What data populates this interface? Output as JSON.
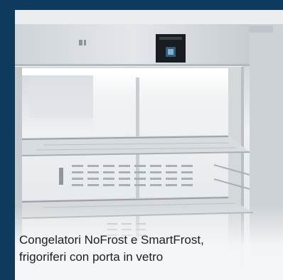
{
  "caption": {
    "line1": "Congelatori NoFrost e SmartFrost,",
    "line2": "frigoriferi con porta in vetro"
  },
  "colors": {
    "background": "#0e3a5e",
    "caption_text": "#1b1f23",
    "cabinet_steel": "#d9dde0"
  },
  "icons": [
    "control-panel-display-icon",
    "door-handle-icon",
    "logo-mark-icon"
  ]
}
